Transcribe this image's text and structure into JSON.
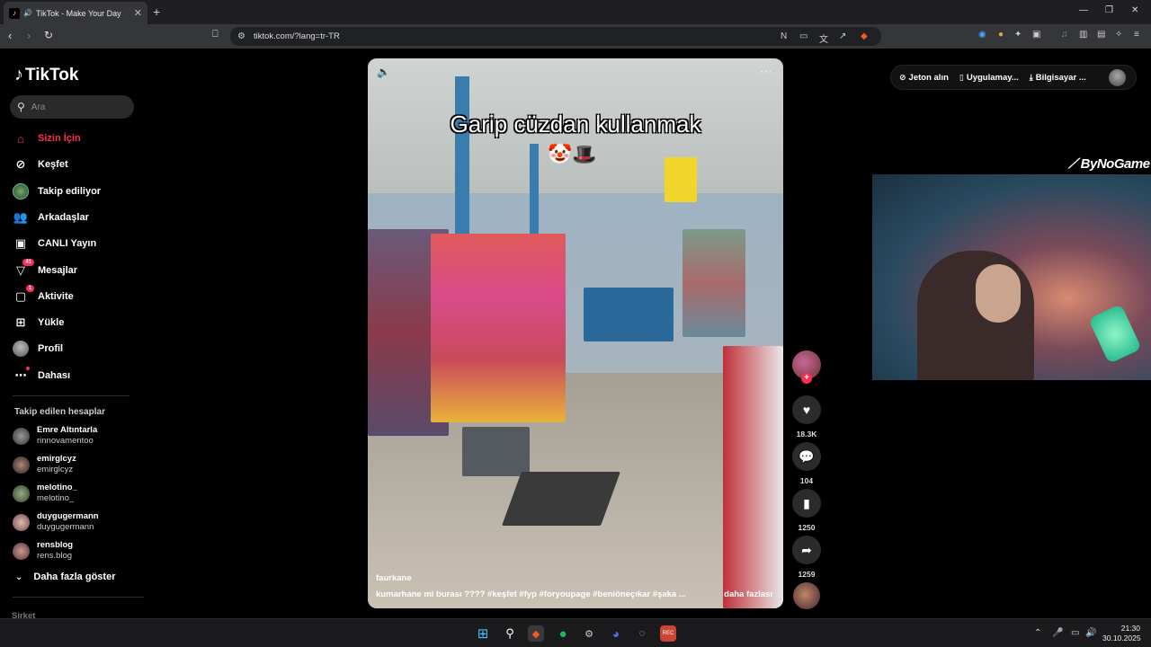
{
  "browser": {
    "tab_title": "TikTok - Make Your Day",
    "url": "tiktok.com/?lang=tr-TR",
    "window_controls": [
      "minimize-icon",
      "restore-icon",
      "close-icon"
    ]
  },
  "sidebar": {
    "logo": "TikTok",
    "search_placeholder": "Ara",
    "nav": [
      {
        "label": "Sizin İçin",
        "icon": "home-icon",
        "active": true
      },
      {
        "label": "Keşfet",
        "icon": "compass-icon"
      },
      {
        "label": "Takip ediliyor",
        "icon": "following-avatar"
      },
      {
        "label": "Arkadaşlar",
        "icon": "friends-icon"
      },
      {
        "label": "CANLI Yayın",
        "icon": "live-icon"
      },
      {
        "label": "Mesajlar",
        "icon": "messages-icon",
        "badge": "41"
      },
      {
        "label": "Aktivite",
        "icon": "activity-icon",
        "badge": "1"
      },
      {
        "label": "Yükle",
        "icon": "upload-icon"
      },
      {
        "label": "Profil",
        "icon": "profile-icon"
      },
      {
        "label": "Dahası",
        "icon": "more-icon"
      }
    ],
    "following_title": "Takip edilen hesaplar",
    "accounts": [
      {
        "name": "Emre Altıntarla",
        "username": "rinnovamentoo"
      },
      {
        "name": "emirglcyz",
        "username": "emirglcyz"
      },
      {
        "name": "melotino_",
        "username": "melotino_"
      },
      {
        "name": "duygugermann",
        "username": "duygugermann"
      },
      {
        "name": "rensblog",
        "username": "rens.blog"
      }
    ],
    "show_more": "Daha fazla göster",
    "company": "Şirket"
  },
  "video": {
    "caption": "Garip cüzdan kullanmak",
    "author": "faurkane",
    "description": "kumarhane mi burası ???? #keşfet #fyp #foryoupage #beniöneçıkar #şaka ...",
    "more_label": "daha fazlası"
  },
  "actions": {
    "likes": "18.3K",
    "comments": "104",
    "saves": "1250",
    "shares": "1259"
  },
  "topbar": {
    "coins": "Jeton alın",
    "app": "Uygulamay...",
    "desktop": "Bilgisayar ..."
  },
  "overlay": {
    "brand": "ByNoGame"
  },
  "taskbar": {
    "time": "21:30",
    "date": "30.10.2025"
  },
  "colors": {
    "accent": "#fe2c55",
    "background": "#000000",
    "browser_chrome": "#35363a"
  }
}
